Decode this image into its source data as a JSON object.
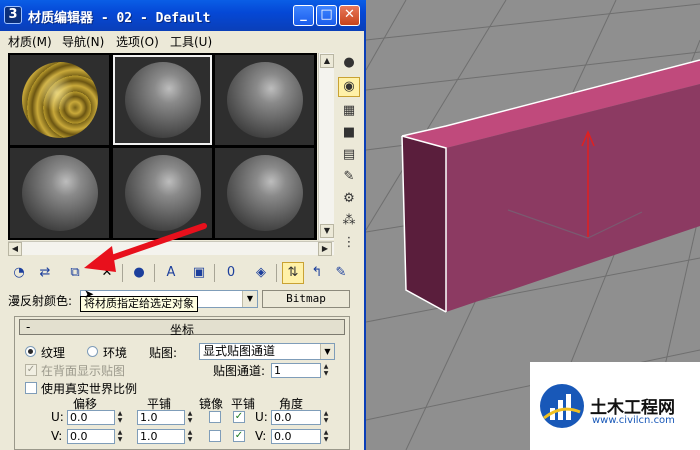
{
  "window": {
    "title": "材质编辑器 - 02 - Default",
    "app_icon": "3",
    "controls": {
      "minimize": "_",
      "maximize": "□",
      "close": "✕"
    }
  },
  "menu": [
    "材质(M)",
    "导航(N)",
    "选项(O)",
    "工具(U)"
  ],
  "slots": {
    "count": 6,
    "selected_index": 1,
    "first_material": "gold-wood"
  },
  "side_tools": [
    "sample-type-icon",
    "backlight-icon",
    "background-icon",
    "uv-tiling-icon",
    "video-color-check-icon",
    "make-preview-icon",
    "options-icon",
    "select-by-material-icon",
    "material-map-navigator-icon"
  ],
  "toolbar_icons": [
    "get-material-icon",
    "put-to-scene-icon",
    "assign-to-selection-icon",
    "reset-map-icon",
    "make-unique-icon",
    "put-to-library-icon",
    "material-effects-channel-icon",
    "show-map-icon",
    "show-end-result-icon",
    "go-to-parent-icon",
    "go-forward-sibling-icon"
  ],
  "diffuse": {
    "label": "漫反射颜色:",
    "name_value": "",
    "type_button": "Bitmap"
  },
  "tooltip": "将材质指定给选定对象",
  "coordinates": {
    "title": "坐标",
    "collapse": "-",
    "texture_label": "纹理",
    "environ_label": "环境",
    "mapping_label": "贴图:",
    "mapping_value": "显式贴图通道",
    "show_on_back_label": "在背面显示贴图",
    "map_channel_label": "贴图通道:",
    "map_channel_value": "1",
    "real_world_label": "使用真实世界比例",
    "col_offset": "偏移",
    "col_tiling": "平铺",
    "col_mirror": "镜像",
    "col_tile": "平铺",
    "col_angle": "角度",
    "u_label": "U:",
    "v_label": "V:",
    "u_offset": "0.0",
    "v_offset": "0.0",
    "u_tiling": "1.0",
    "v_tiling": "1.0",
    "u_angle": "0.0",
    "v_angle": "0.0",
    "u_mirror": false,
    "v_mirror": false,
    "u_tile": true,
    "v_tile": true
  },
  "watermark": {
    "title": "土木工程网",
    "url": "www.civilcn.com"
  }
}
